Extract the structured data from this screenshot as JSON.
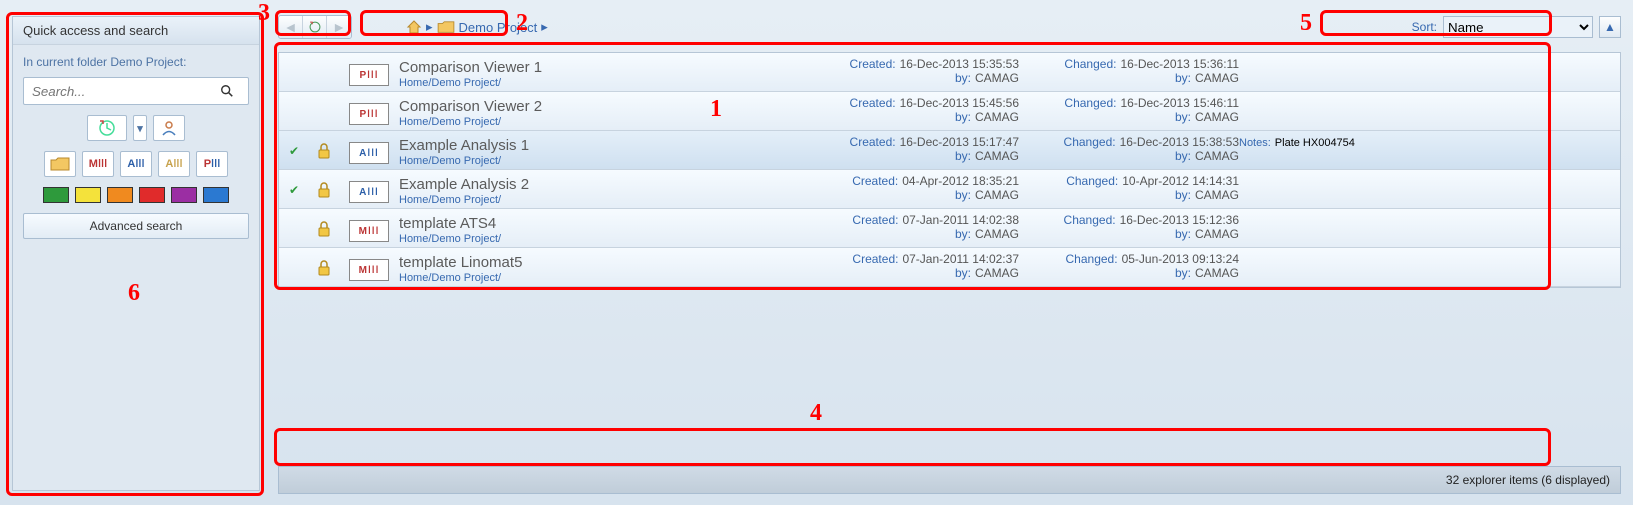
{
  "sidebar": {
    "title": "Quick access and search",
    "scope": "In current folder Demo Project:",
    "search_placeholder": "Search...",
    "type_filters": [
      "M",
      "A",
      "A",
      "P"
    ],
    "advanced_label": "Advanced search",
    "colors": [
      "#2e9a3c",
      "#f4e23b",
      "#f08a1f",
      "#e02b2b",
      "#9b2ea3",
      "#2b79d1"
    ]
  },
  "nav": {
    "breadcrumb_label": "Demo Project"
  },
  "sort": {
    "label": "Sort:",
    "selected": "Name"
  },
  "items": [
    {
      "check": false,
      "lock": false,
      "tag": "P",
      "tag_class": "p",
      "title": "Comparison Viewer 1",
      "path": "Home/Demo Project/",
      "created": "16-Dec-2013 15:35:53",
      "created_by": "CAMAG",
      "changed": "16-Dec-2013 15:36:11",
      "changed_by": "CAMAG",
      "notes": ""
    },
    {
      "check": false,
      "lock": false,
      "tag": "P",
      "tag_class": "p",
      "title": "Comparison Viewer 2",
      "path": "Home/Demo Project/",
      "created": "16-Dec-2013 15:45:56",
      "created_by": "CAMAG",
      "changed": "16-Dec-2013 15:46:11",
      "changed_by": "CAMAG",
      "notes": ""
    },
    {
      "check": true,
      "lock": true,
      "tag": "A",
      "tag_class": "a",
      "title": "Example Analysis 1",
      "path": "Home/Demo Project/",
      "created": "16-Dec-2013 15:17:47",
      "created_by": "CAMAG",
      "changed": "16-Dec-2013 15:38:53",
      "changed_by": "CAMAG",
      "notes": "Plate HX004754",
      "selected": true
    },
    {
      "check": true,
      "lock": true,
      "tag": "A",
      "tag_class": "a",
      "title": "Example Analysis 2",
      "path": "Home/Demo Project/",
      "created": "04-Apr-2012 18:35:21",
      "created_by": "CAMAG",
      "changed": "10-Apr-2012 14:14:31",
      "changed_by": "CAMAG",
      "notes": ""
    },
    {
      "check": false,
      "lock": true,
      "tag": "M",
      "tag_class": "m",
      "title": "template ATS4",
      "path": "Home/Demo Project/",
      "created": "07-Jan-2011 14:02:38",
      "created_by": "CAMAG",
      "changed": "16-Dec-2013 15:12:36",
      "changed_by": "CAMAG",
      "notes": ""
    },
    {
      "check": false,
      "lock": true,
      "tag": "M",
      "tag_class": "m",
      "title": "template Linomat5",
      "path": "Home/Demo Project/",
      "created": "07-Jan-2011 14:02:37",
      "created_by": "CAMAG",
      "changed": "05-Jun-2013 09:13:24",
      "changed_by": "CAMAG",
      "notes": ""
    }
  ],
  "labels": {
    "created": "Created:",
    "changed": "Changed:",
    "by": "by:",
    "notes": "Notes:"
  },
  "status": "32 explorer items (6 displayed)",
  "annotations": {
    "1": "1",
    "2": "2",
    "3": "3",
    "4": "4",
    "5": "5",
    "6": "6"
  }
}
